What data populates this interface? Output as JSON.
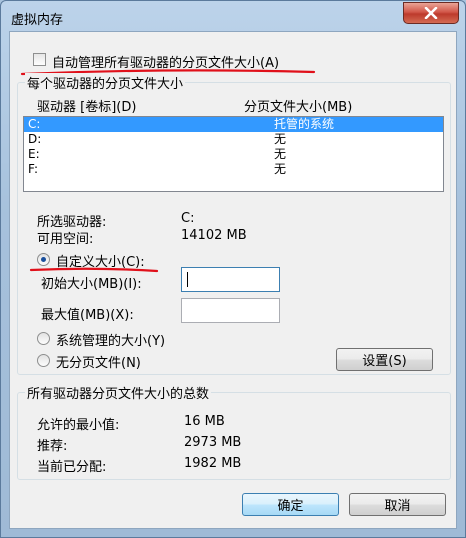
{
  "window": {
    "title": "虚拟内存"
  },
  "auto_manage": {
    "label": "自动管理所有驱动器的分页文件大小(A)",
    "checked": false
  },
  "drives_group": {
    "legend": "每个驱动器的分页文件大小",
    "col_drive": "驱动器 [卷标](D)",
    "col_size": "分页文件大小(MB)",
    "rows": [
      {
        "drive": "C:",
        "size": "托管的系统",
        "selected": true
      },
      {
        "drive": "D:",
        "size": "无",
        "selected": false
      },
      {
        "drive": "E:",
        "size": "无",
        "selected": false
      },
      {
        "drive": "F:",
        "size": "无",
        "selected": false
      }
    ],
    "selected_drive_label": "所选驱动器:",
    "selected_drive_value": "C:",
    "free_space_label": "可用空间:",
    "free_space_value": "14102 MB",
    "custom_size_label": "自定义大小(C):",
    "initial_size_label": "初始大小(MB)(I):",
    "initial_size_value": "",
    "max_size_label": "最大值(MB)(X):",
    "max_size_value": "",
    "system_managed_label": "系统管理的大小(Y)",
    "no_paging_label": "无分页文件(N)",
    "set_button": "设置(S)"
  },
  "total_group": {
    "legend": "所有驱动器分页文件大小的总数",
    "min_label": "允许的最小值:",
    "min_value": "16 MB",
    "recommended_label": "推荐:",
    "recommended_value": "2973 MB",
    "current_label": "当前已分配:",
    "current_value": "1982 MB"
  },
  "buttons": {
    "ok": "确定",
    "cancel": "取消"
  },
  "annotation_color": "#e0101a"
}
